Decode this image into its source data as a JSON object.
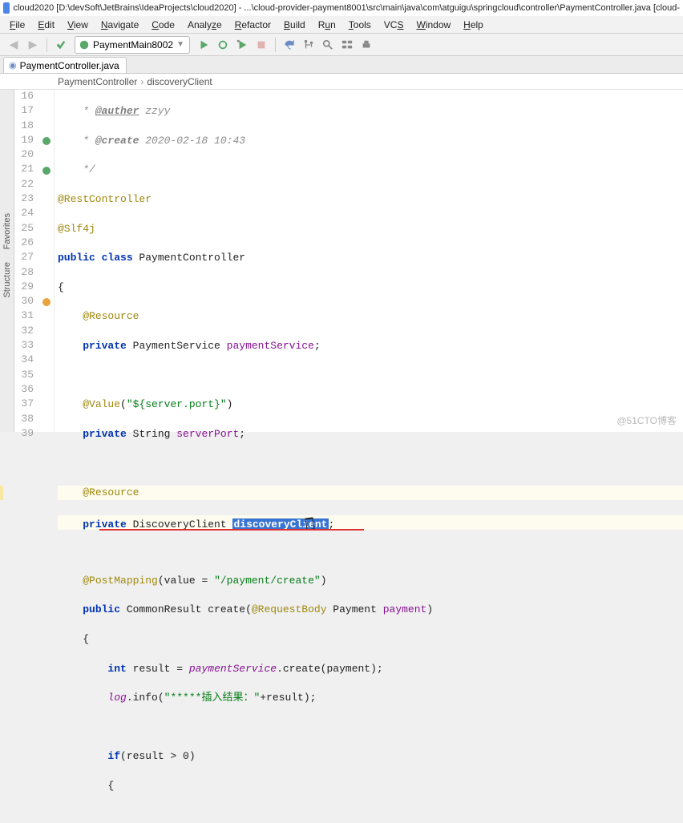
{
  "title": "cloud2020 [D:\\devSoft\\JetBrains\\IdeaProjects\\cloud2020] - ...\\cloud-provider-payment8001\\src\\main\\java\\com\\atguigu\\springcloud\\controller\\PaymentController.java [cloud-",
  "menu": {
    "file": "File",
    "edit": "Edit",
    "view": "View",
    "navigate": "Navigate",
    "code": "Code",
    "analyze": "Analyze",
    "refactor": "Refactor",
    "build": "Build",
    "run": "Run",
    "tools": "Tools",
    "vcs": "VCS",
    "window": "Window",
    "help": "Help"
  },
  "run_config": "PaymentMain8002",
  "tab_name": "PaymentController.java",
  "breadcrumb": {
    "a": "PaymentController",
    "b": "discoveryClient"
  },
  "side_tabs": {
    "favorites": "Favorites",
    "structure": "Structure"
  },
  "lines": {
    "start": 16,
    "count": 24
  },
  "code": {
    "l16_auther": "@auther",
    "l16_name": " zzyy",
    "l17_create": "@create",
    "l17_date": " 2020-02-18 10:43",
    "l19_anno": "@RestController",
    "l20_anno": "@Slf4j",
    "l21_pub": "public ",
    "l21_class": "class ",
    "l21_name": "PaymentController",
    "l23_anno": "@Resource",
    "l24_priv": "private ",
    "l24_type": "PaymentService ",
    "l24_var": "paymentService",
    "l26_anno": "@Value",
    "l26_args": "(\"${server.port}\")",
    "l27_priv": "private ",
    "l27_type": "String ",
    "l27_var": "serverPort",
    "l29_anno": "@Resource",
    "l30_priv": "private ",
    "l30_type": "DiscoveryClient ",
    "l30_var": "discoveryClient",
    "l32_anno": "@PostMapping",
    "l32_pre": "(value = ",
    "l32_str": "\"/payment/create\"",
    "l32_post": ")",
    "l33_pub": "public ",
    "l33_type": "CommonResult ",
    "l33_method": "create",
    "l33_open": "(",
    "l33_anno": "@RequestBody",
    "l33_ptype": " Payment ",
    "l33_pvar": "payment",
    "l33_close": ")",
    "l35_int": "int ",
    "l35_var": "result = ",
    "l35_ref": "paymentService",
    "l35_call": ".create(payment);",
    "l36_log": "log",
    "l36_info": ".info(",
    "l36_str": "\"*****插入结果：\"",
    "l36_end": "+result);",
    "l38_if": "if",
    "l38_cond": "(result > 0)"
  },
  "watermark": "@51CTO博客"
}
